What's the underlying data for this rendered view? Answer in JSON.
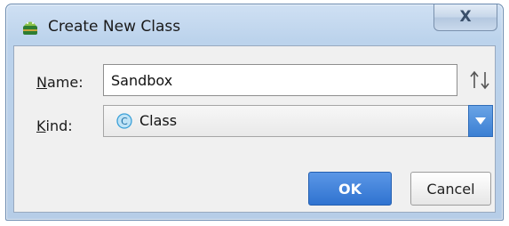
{
  "window": {
    "title": "Create New Class",
    "close_glyph": "X"
  },
  "form": {
    "name_label_mnemonic": "N",
    "name_label_rest": "ame:",
    "name_value": "Sandbox",
    "kind_label_mnemonic": "K",
    "kind_label_rest": "ind:",
    "kind_value": "Class",
    "kind_icon_letter": "C"
  },
  "icons": {
    "app": "android-icon",
    "sort": "sort-arrows-icon",
    "kind": "class-icon",
    "dropdown": "chevron-down-icon"
  },
  "buttons": {
    "ok_label": "OK",
    "cancel_label": "Cancel"
  },
  "colors": {
    "primary_button": "#3b7fd3",
    "dropdown_arrow_bg": "#4a8ddb",
    "class_icon": "#3aa0d8",
    "android_green": "#8bc34a"
  }
}
